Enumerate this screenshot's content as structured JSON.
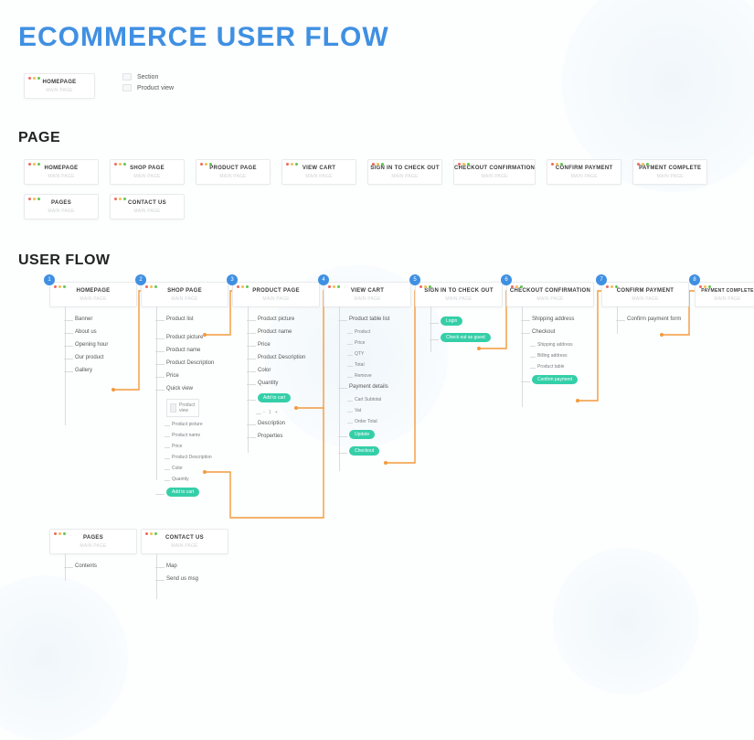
{
  "title": "ECOMMERCE USER FLOW",
  "legend": {
    "sample_page_title": "HOMEPAGE",
    "sample_page_sub": "MAIN PAGE",
    "section_label": "Section",
    "product_view_label": "Product view"
  },
  "sections": {
    "page": "PAGE",
    "user_flow": "USER FLOW"
  },
  "page_cards_sub": "MAIN PAGE",
  "page_cards": [
    "HOMEPAGE",
    "SHOP PAGE",
    "PRODUCT PAGE",
    "VIEW CART",
    "SIGN IN TO CHECK OUT",
    "CHECKOUT CONFIRMATION",
    "CONFIRM PAYMENT",
    "PAYMENT COMPLETE"
  ],
  "page_cards_row2": [
    "PAGES",
    "CONTACT US"
  ],
  "flow": {
    "homepage": {
      "title": "HOMEPAGE",
      "badge": "1",
      "sub": "MAIN PAGE",
      "items": [
        "Banner",
        "About us",
        "Opening hour",
        "Our product",
        "Gallery"
      ]
    },
    "shop": {
      "title": "SHOP PAGE",
      "badge": "2",
      "sub": "MAIN PAGE",
      "product_list": "Product list",
      "items": [
        "Product picture",
        "Product name",
        "Product Description",
        "Price",
        "Quick view"
      ],
      "product_view_label": "Product view",
      "pv_sub": [
        "Product picture",
        "Product name",
        "Price",
        "Product Description",
        "Color",
        "Quantity"
      ],
      "add": "Add to cart"
    },
    "product": {
      "title": "PRODUCT PAGE",
      "badge": "3",
      "sub": "MAIN PAGE",
      "items": [
        "Product picture",
        "Product name",
        "Price",
        "Product Description",
        "Color",
        "Quantity"
      ],
      "add": "Add to cart",
      "items2": [
        "Description",
        "Properties"
      ]
    },
    "cart": {
      "title": "VIEW CART",
      "badge": "4",
      "sub": "MAIN PAGE",
      "table": "Product table list",
      "table_items": [
        "Product",
        "Price",
        "QTY",
        "Total",
        "Remove"
      ],
      "payment": "Payment details",
      "payment_items": [
        "Cart Subtotal",
        "Vat",
        "Order Total"
      ],
      "update": "Update",
      "checkout": "Checkout"
    },
    "signin": {
      "title": "SIGN IN TO CHECK OUT",
      "badge": "5",
      "sub": "MAIN PAGE",
      "login": "Login",
      "guest": "Check out as guest"
    },
    "checkout": {
      "title": "CHECKOUT CONFIRMATION",
      "badge": "6",
      "sub": "MAIN PAGE",
      "items": [
        "Shipping address",
        "Checkout"
      ],
      "sub_items": [
        "Shipping address",
        "Billing address",
        "Product table"
      ],
      "confirm": "Confirm payment"
    },
    "confirm": {
      "title": "CONFIRM PAYMENT",
      "badge": "7",
      "sub": "MAIN PAGE",
      "item": "Confirm payment form"
    },
    "complete": {
      "title": "PAYMENT COMPLETE",
      "badge": "8",
      "sub": "MAIN PAGE"
    },
    "pages": {
      "title": "PAGES",
      "sub": "MAIN PAGE",
      "items": [
        "Contents"
      ]
    },
    "contact": {
      "title": "CONTACT US",
      "sub": "MAIN PAGE",
      "items": [
        "Map",
        "Send us msg"
      ]
    }
  }
}
